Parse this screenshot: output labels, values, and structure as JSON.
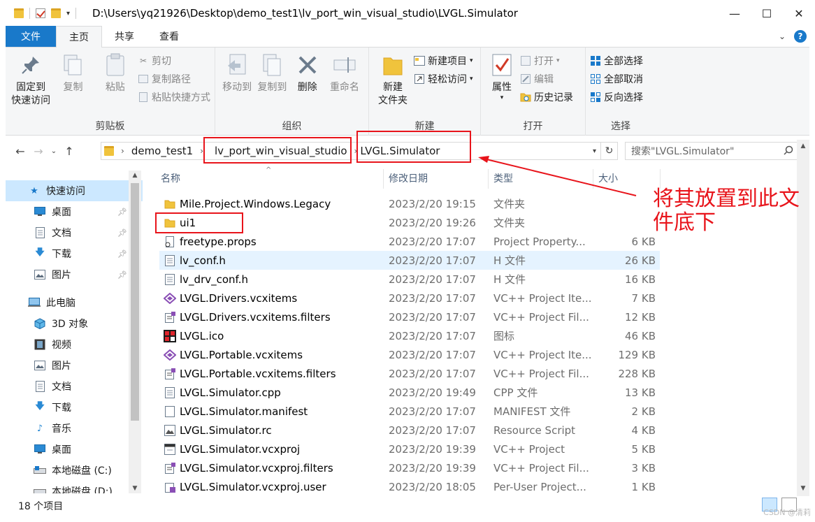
{
  "titlebar": {
    "path": "D:\\Users\\yq21926\\Desktop\\demo_test1\\lv_port_win_visual_studio\\LVGL.Simulator",
    "minimize": "—",
    "maximize": "☐",
    "close": "✕"
  },
  "tabs": {
    "file": "文件",
    "home": "主页",
    "share": "共享",
    "view": "查看",
    "help": "?"
  },
  "ribbon": {
    "clipboard": {
      "label": "剪贴板",
      "pin": "固定到\n快速访问",
      "copy": "复制",
      "paste": "粘贴",
      "cut": "剪切",
      "copy_path": "复制路径",
      "paste_shortcut": "粘贴快捷方式"
    },
    "organize": {
      "label": "组织",
      "move_to": "移动到",
      "copy_to": "复制到",
      "delete": "删除",
      "rename": "重命名"
    },
    "new": {
      "label": "新建",
      "new_folder": "新建\n文件夹",
      "new_item": "新建项目",
      "easy_access": "轻松访问"
    },
    "open": {
      "label": "打开",
      "properties": "属性",
      "open": "打开",
      "edit": "编辑",
      "history": "历史记录"
    },
    "select": {
      "label": "选择",
      "select_all": "全部选择",
      "select_none": "全部取消",
      "invert": "反向选择"
    }
  },
  "address": {
    "crumbs": [
      "demo_test1",
      "lv_port_win_visual_studio",
      "LVGL.Simulator"
    ],
    "search_placeholder": "搜索\"LVGL.Simulator\""
  },
  "sidebar": {
    "items": [
      {
        "label": "快速访问",
        "icon": "star-icon",
        "selected": true
      },
      {
        "label": "桌面",
        "icon": "desktop-icon",
        "pinned": true
      },
      {
        "label": "文档",
        "icon": "document-icon",
        "pinned": true
      },
      {
        "label": "下载",
        "icon": "download-icon",
        "pinned": true
      },
      {
        "label": "图片",
        "icon": "picture-icon",
        "pinned": true
      },
      {
        "label": "此电脑",
        "icon": "computer-icon"
      },
      {
        "label": "3D 对象",
        "icon": "cube-icon"
      },
      {
        "label": "视频",
        "icon": "video-icon"
      },
      {
        "label": "图片",
        "icon": "picture-icon"
      },
      {
        "label": "文档",
        "icon": "document-icon"
      },
      {
        "label": "下载",
        "icon": "download-icon"
      },
      {
        "label": "音乐",
        "icon": "music-icon"
      },
      {
        "label": "桌面",
        "icon": "desktop-icon"
      },
      {
        "label": "本地磁盘 (C:)",
        "icon": "drive-icon"
      },
      {
        "label": "本地磁盘 (D:)",
        "icon": "drive-icon"
      }
    ]
  },
  "columns": {
    "name": "名称",
    "date": "修改日期",
    "type": "类型",
    "size": "大小"
  },
  "files": [
    {
      "name": "Mile.Project.Windows.Legacy",
      "date": "2023/2/20 19:15",
      "type": "文件夹",
      "size": "",
      "icon": "folder-icon"
    },
    {
      "name": "ui1",
      "date": "2023/2/20 19:26",
      "type": "文件夹",
      "size": "",
      "icon": "folder-icon"
    },
    {
      "name": "freetype.props",
      "date": "2023/2/20 17:07",
      "type": "Project Property...",
      "size": "6 KB",
      "icon": "props-file-icon"
    },
    {
      "name": "lv_conf.h",
      "date": "2023/2/20 17:07",
      "type": "H 文件",
      "size": "26 KB",
      "icon": "text-file-icon"
    },
    {
      "name": "lv_drv_conf.h",
      "date": "2023/2/20 17:07",
      "type": "H 文件",
      "size": "16 KB",
      "icon": "text-file-icon"
    },
    {
      "name": "LVGL.Drivers.vcxitems",
      "date": "2023/2/20 17:07",
      "type": "VC++ Project Ite...",
      "size": "7 KB",
      "icon": "vs-items-icon"
    },
    {
      "name": "LVGL.Drivers.vcxitems.filters",
      "date": "2023/2/20 17:07",
      "type": "VC++ Project Fil...",
      "size": "12 KB",
      "icon": "filters-file-icon"
    },
    {
      "name": "LVGL.ico",
      "date": "2023/2/20 17:07",
      "type": "图标",
      "size": "46 KB",
      "icon": "lvgl-ico-icon"
    },
    {
      "name": "LVGL.Portable.vcxitems",
      "date": "2023/2/20 17:07",
      "type": "VC++ Project Ite...",
      "size": "129 KB",
      "icon": "vs-items-icon"
    },
    {
      "name": "LVGL.Portable.vcxitems.filters",
      "date": "2023/2/20 17:07",
      "type": "VC++ Project Fil...",
      "size": "228 KB",
      "icon": "filters-file-icon"
    },
    {
      "name": "LVGL.Simulator.cpp",
      "date": "2023/2/20 19:49",
      "type": "CPP 文件",
      "size": "13 KB",
      "icon": "text-file-icon"
    },
    {
      "name": "LVGL.Simulator.manifest",
      "date": "2023/2/20 17:07",
      "type": "MANIFEST 文件",
      "size": "2 KB",
      "icon": "blank-file-icon"
    },
    {
      "name": "LVGL.Simulator.rc",
      "date": "2023/2/20 17:07",
      "type": "Resource Script",
      "size": "4 KB",
      "icon": "rc-file-icon"
    },
    {
      "name": "LVGL.Simulator.vcxproj",
      "date": "2023/2/20 19:39",
      "type": "VC++ Project",
      "size": "5 KB",
      "icon": "vcxproj-icon"
    },
    {
      "name": "LVGL.Simulator.vcxproj.filters",
      "date": "2023/2/20 19:39",
      "type": "VC++ Project Fil...",
      "size": "3 KB",
      "icon": "filters-file-icon"
    },
    {
      "name": "LVGL.Simulator.vcxproj.user",
      "date": "2023/2/20 18:05",
      "type": "Per-User Project...",
      "size": "1 KB",
      "icon": "vs-user-icon"
    }
  ],
  "highlighted_file": "lv_conf.h",
  "status": {
    "count": "18 个项目"
  },
  "annotation": {
    "text": "将其放置到此文件底下",
    "color": "#e8141b"
  },
  "watermark": "CSDN @清莉",
  "colors": {
    "accent": "#1979ca",
    "selection": "#cce8ff",
    "hover": "#e5f3ff",
    "folder": "#f0c33c"
  }
}
